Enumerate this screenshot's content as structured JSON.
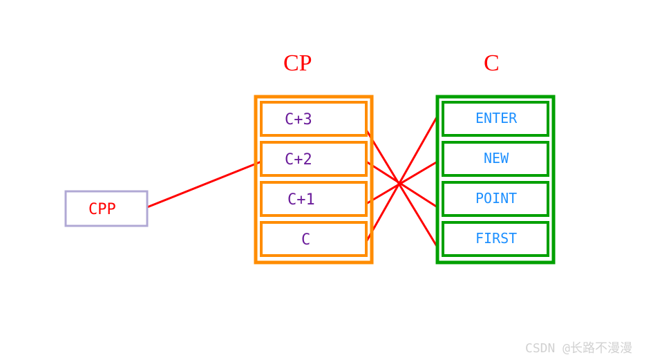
{
  "titles": {
    "cp": "CP",
    "c": "C"
  },
  "cpp_box": {
    "label": "CPP"
  },
  "cp_items": [
    {
      "label": "C+3"
    },
    {
      "label": "C+2"
    },
    {
      "label": "C+1"
    },
    {
      "label": "C"
    }
  ],
  "c_items": [
    {
      "label": "ENTER"
    },
    {
      "label": "NEW"
    },
    {
      "label": "POINT"
    },
    {
      "label": "FIRST"
    }
  ],
  "watermark": "CSDN @长路不漫漫",
  "colors": {
    "red": "#ff0000",
    "orange": "#ff8c00",
    "green": "#00a000",
    "purple": "#b0a8d4",
    "blue": "#1e90ff",
    "violet": "#6a1b9a"
  },
  "chart_data": {
    "type": "diagram",
    "description": "Pointer indirection diagram: CPP points into CP array; each CP[i] holds pointer value C+i; cross (reversed) arrows map CP entries to C string literals.",
    "mappings": [
      {
        "cp": "C+3",
        "c": "FIRST"
      },
      {
        "cp": "C+2",
        "c": "POINT"
      },
      {
        "cp": "C+1",
        "c": "NEW"
      },
      {
        "cp": "C",
        "c": "ENTER"
      }
    ]
  }
}
